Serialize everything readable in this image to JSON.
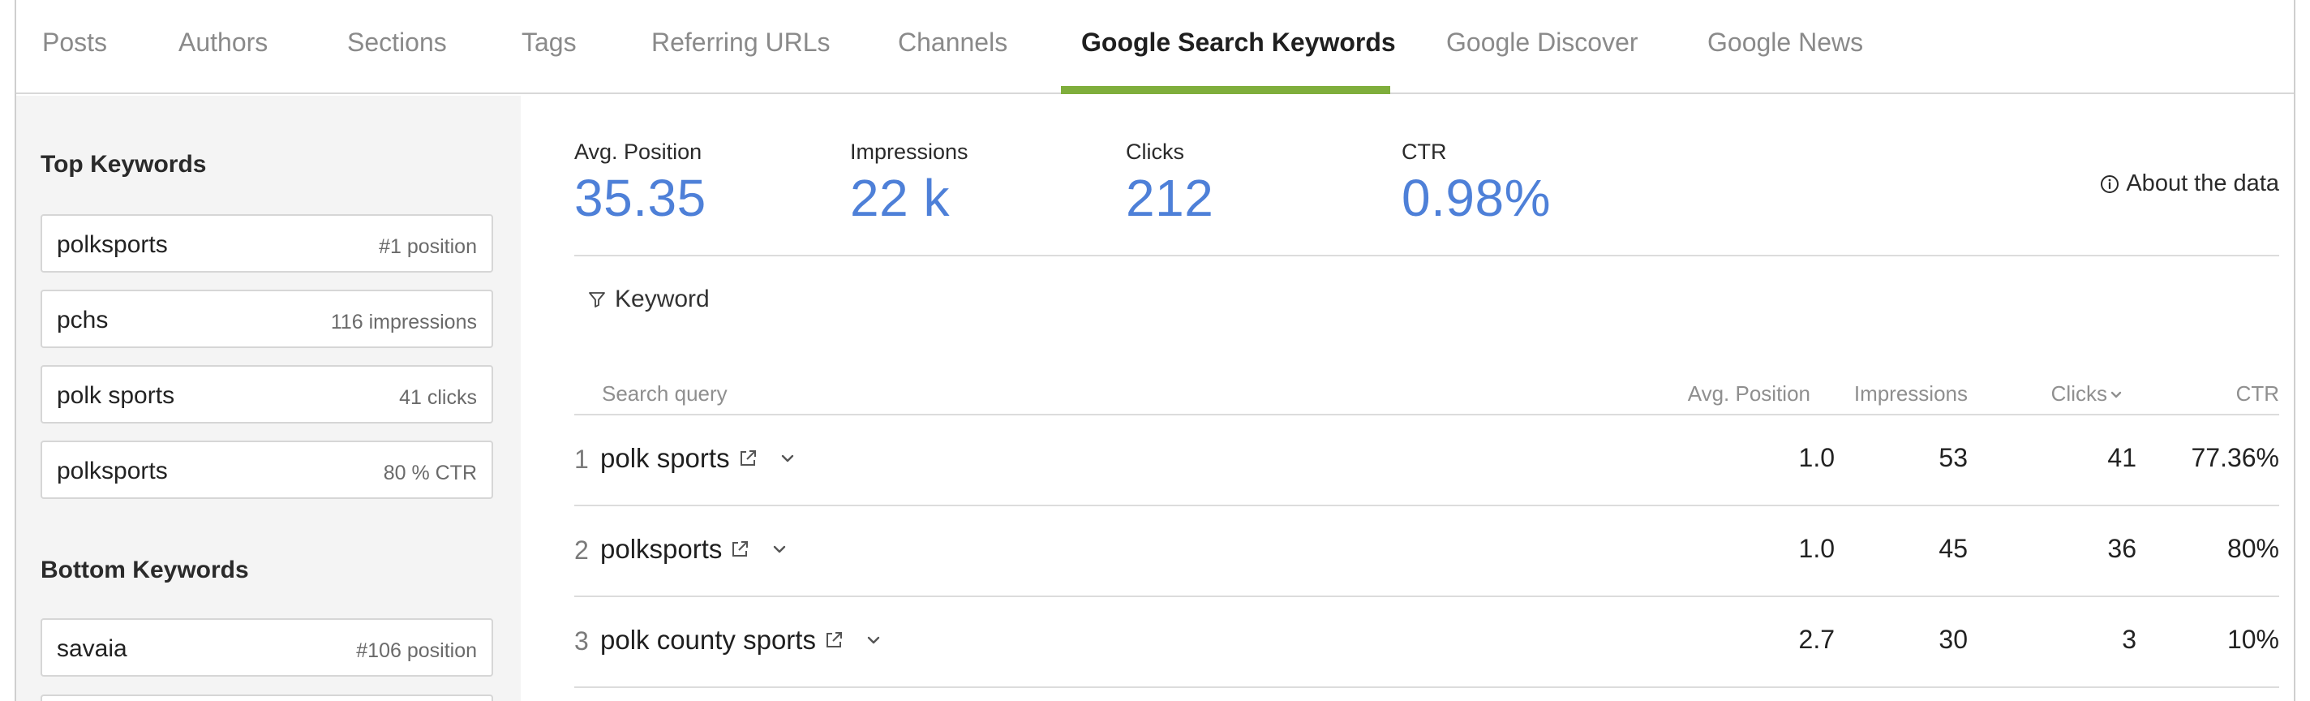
{
  "tabs": [
    {
      "label": "Posts"
    },
    {
      "label": "Authors"
    },
    {
      "label": "Sections"
    },
    {
      "label": "Tags"
    },
    {
      "label": "Referring URLs"
    },
    {
      "label": "Channels"
    },
    {
      "label": "Google Search Keywords"
    },
    {
      "label": "Google Discover"
    },
    {
      "label": "Google News"
    }
  ],
  "active_tab": "Google Search Keywords",
  "colors": {
    "accent_underline": "#7fae3c",
    "stat_value": "#4e80d8"
  },
  "sidebar": {
    "top_heading": "Top Keywords",
    "top_keywords": [
      {
        "name": "polksports",
        "meta": "#1 position"
      },
      {
        "name": "pchs",
        "meta": "116 impressions"
      },
      {
        "name": "polk sports",
        "meta": "41 clicks"
      },
      {
        "name": "polksports",
        "meta": "80 % CTR"
      }
    ],
    "bottom_heading": "Bottom Keywords",
    "bottom_keywords": [
      {
        "name": "savaia",
        "meta": "#106 position"
      }
    ]
  },
  "stats": [
    {
      "label": "Avg. Position",
      "value": "35.35"
    },
    {
      "label": "Impressions",
      "value": "22 k"
    },
    {
      "label": "Clicks",
      "value": "212"
    },
    {
      "label": "CTR",
      "value": "0.98%"
    }
  ],
  "about_label": "About the data",
  "filter_label": "Keyword",
  "table": {
    "headers": {
      "query": "Search query",
      "avg_position": "Avg. Position",
      "impressions": "Impressions",
      "clicks": "Clicks",
      "ctr": "CTR"
    },
    "rows": [
      {
        "rank": "1",
        "query": "polk sports",
        "avg_position": "1.0",
        "impressions": "53",
        "clicks": "41",
        "ctr": "77.36%"
      },
      {
        "rank": "2",
        "query": "polksports",
        "avg_position": "1.0",
        "impressions": "45",
        "clicks": "36",
        "ctr": "80%"
      },
      {
        "rank": "3",
        "query": "polk county sports",
        "avg_position": "2.7",
        "impressions": "30",
        "clicks": "3",
        "ctr": "10%"
      }
    ]
  }
}
